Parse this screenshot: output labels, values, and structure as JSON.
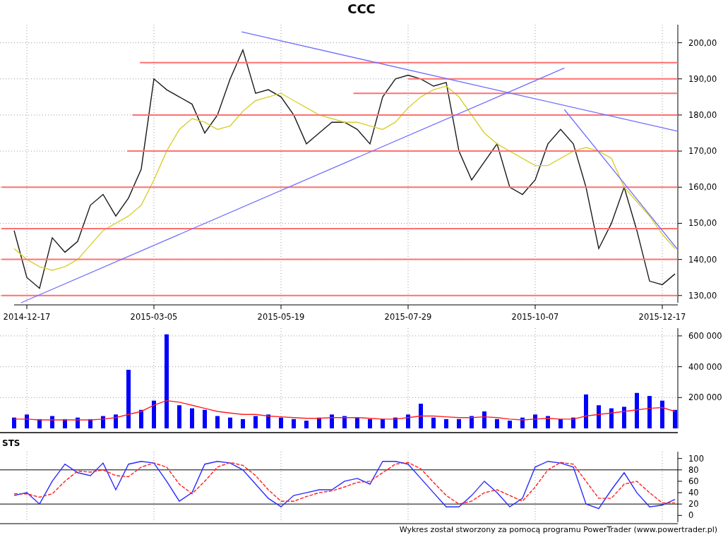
{
  "title": "CCC",
  "price_chart": {
    "chart_data": {
      "type": "line",
      "grid": true,
      "ylim": [
        128,
        205
      ],
      "categories": [
        null,
        "2014-12-17",
        null,
        null,
        null,
        null,
        null,
        null,
        null,
        null,
        null,
        "2015-03-05",
        null,
        null,
        null,
        null,
        null,
        null,
        null,
        null,
        null,
        "2015-05-19",
        null,
        null,
        null,
        null,
        null,
        null,
        null,
        null,
        null,
        "2015-07-29",
        null,
        null,
        null,
        null,
        null,
        null,
        null,
        null,
        null,
        "2015-10-07",
        null,
        null,
        null,
        null,
        null,
        null,
        null,
        null,
        null,
        "2015-12-17",
        null
      ],
      "yticks": [
        {
          "value": 130,
          "label": "130,00"
        },
        {
          "value": 140,
          "label": "140,00"
        },
        {
          "value": 150,
          "label": "150,00"
        },
        {
          "value": 160,
          "label": "160,00"
        },
        {
          "value": 170,
          "label": "170,00"
        },
        {
          "value": 180,
          "label": "180,00"
        },
        {
          "value": 190,
          "label": "190,00"
        },
        {
          "value": 200,
          "label": "200,00"
        }
      ],
      "series": [
        {
          "color": "#1a1a1a",
          "values": [
            148,
            135,
            132,
            146,
            142,
            145,
            155,
            158,
            152,
            157,
            165,
            190,
            187,
            185,
            183,
            175,
            180,
            190,
            198,
            186,
            187,
            185,
            180,
            172,
            175,
            178,
            178,
            176,
            172,
            185,
            190,
            191,
            190,
            188,
            189,
            170,
            162,
            167,
            172,
            160,
            158,
            162,
            172,
            176,
            172,
            160,
            143,
            150,
            160,
            148,
            134,
            133,
            136
          ]
        },
        {
          "color": "#d8d030",
          "values": [
            143,
            140,
            138,
            137,
            138,
            140,
            144,
            148,
            150,
            152,
            155,
            162,
            170,
            176,
            179,
            178,
            176,
            177,
            181,
            184,
            185,
            186,
            184,
            182,
            180,
            179,
            178,
            178,
            177,
            176,
            178,
            182,
            185,
            187,
            188,
            185,
            180,
            175,
            172,
            170,
            168,
            166,
            166,
            168,
            170,
            171,
            170,
            168,
            160,
            156,
            152,
            147,
            143
          ]
        }
      ]
    }
  },
  "volume_chart": {
    "chart_data": {
      "type": "bar",
      "grid": true,
      "ylim": [
        0,
        650000
      ],
      "yticks": [
        {
          "value": 200000,
          "label": "200 000"
        },
        {
          "value": 400000,
          "label": "400 000"
        },
        {
          "value": 600000,
          "label": "600 000"
        }
      ],
      "series": [
        {
          "color": "#0000ff",
          "values": [
            70000,
            90000,
            60000,
            80000,
            60000,
            70000,
            60000,
            80000,
            90000,
            380000,
            120000,
            180000,
            610000,
            150000,
            130000,
            120000,
            80000,
            70000,
            60000,
            80000,
            90000,
            70000,
            60000,
            50000,
            70000,
            90000,
            80000,
            70000,
            60000,
            60000,
            70000,
            90000,
            160000,
            70000,
            60000,
            60000,
            80000,
            110000,
            60000,
            50000,
            70000,
            90000,
            80000,
            60000,
            70000,
            220000,
            150000,
            130000,
            140000,
            230000,
            210000,
            180000,
            120000
          ]
        },
        {
          "type": "line",
          "color": "#ff2020",
          "values": [
            60000,
            60000,
            55000,
            55000,
            55000,
            55000,
            55000,
            60000,
            70000,
            90000,
            110000,
            150000,
            180000,
            170000,
            150000,
            130000,
            110000,
            100000,
            90000,
            90000,
            80000,
            75000,
            70000,
            65000,
            65000,
            70000,
            70000,
            70000,
            65000,
            60000,
            60000,
            70000,
            80000,
            80000,
            75000,
            70000,
            70000,
            75000,
            70000,
            60000,
            55000,
            60000,
            65000,
            60000,
            60000,
            80000,
            90000,
            100000,
            110000,
            120000,
            130000,
            135000,
            110000
          ]
        }
      ]
    }
  },
  "sts_panel": {
    "label": "STS",
    "chart_data": {
      "type": "line",
      "grid": true,
      "ylim": [
        -12,
        112
      ],
      "yticks": [
        0,
        20,
        40,
        60,
        80,
        100
      ],
      "series": [
        {
          "color": "#2a2aff",
          "values": [
            35,
            40,
            20,
            60,
            90,
            75,
            70,
            92,
            45,
            90,
            95,
            92,
            60,
            25,
            40,
            90,
            95,
            92,
            80,
            55,
            30,
            15,
            35,
            40,
            45,
            45,
            60,
            65,
            55,
            95,
            95,
            90,
            65,
            40,
            15,
            15,
            35,
            60,
            40,
            15,
            30,
            85,
            95,
            92,
            85,
            20,
            12,
            45,
            75,
            40,
            15,
            18,
            28
          ]
        },
        {
          "color": "#ff2020",
          "line_style": "dashed",
          "values": [
            38,
            38,
            32,
            38,
            60,
            78,
            76,
            80,
            70,
            68,
            85,
            92,
            85,
            55,
            38,
            60,
            85,
            93,
            88,
            70,
            45,
            25,
            25,
            33,
            40,
            43,
            50,
            58,
            60,
            75,
            90,
            93,
            82,
            58,
            35,
            20,
            25,
            40,
            45,
            35,
            25,
            50,
            80,
            93,
            90,
            60,
            30,
            30,
            55,
            60,
            40,
            22,
            22
          ]
        }
      ]
    }
  },
  "footer": "Wykres został stworzony za pomocą programu PowerTrader (www.powertrader.pl)"
}
